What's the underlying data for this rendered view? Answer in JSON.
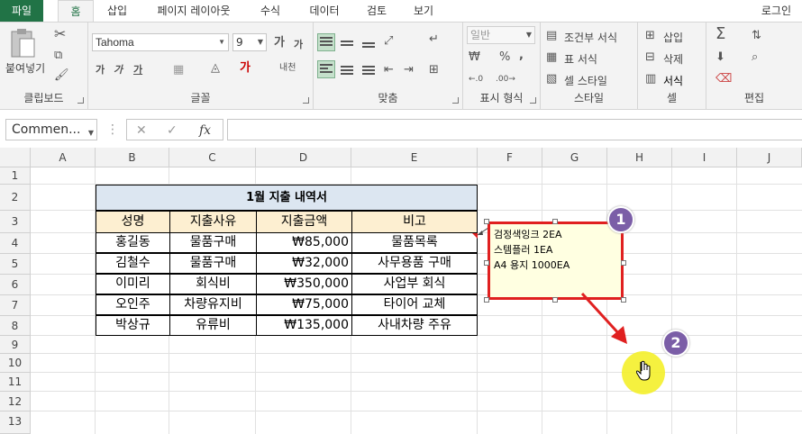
{
  "ribbon_tabs": [
    "파일",
    "홈",
    "삽입",
    "페이지 레이아웃",
    "수식",
    "데이터",
    "검토",
    "보기"
  ],
  "login_label": "로그인",
  "clipboard": {
    "paste_label": "붙여넣기",
    "group_label": "클립보드"
  },
  "font": {
    "name": "Tahoma",
    "size": "9",
    "group_label": "글꼴",
    "bold": "가",
    "italic": "가",
    "underline": "가",
    "grow": "가",
    "shrink": "가",
    "phonetic": "내천"
  },
  "alignment": {
    "group_label": "맞춤"
  },
  "number": {
    "format": "일반",
    "group_label": "표시 형식",
    "percent": "%",
    "comma": ","
  },
  "styles": {
    "conditional": "조건부 서식",
    "table": "표 서식",
    "cell": "셀 스타일",
    "group_label": "스타일"
  },
  "cells": {
    "insert": "삽입",
    "delete": "삭제",
    "format": "서식",
    "group_label": "셀"
  },
  "editing": {
    "group_label": "편집"
  },
  "formula_bar": {
    "name_box": "Commen...",
    "fx": "fx"
  },
  "columns": [
    "A",
    "B",
    "C",
    "D",
    "E",
    "F",
    "G",
    "H",
    "I",
    "J"
  ],
  "rows": [
    "1",
    "2",
    "3",
    "4",
    "5",
    "6",
    "7",
    "8",
    "9",
    "10",
    "11",
    "12",
    "13"
  ],
  "table": {
    "title": "1월 지출 내역서",
    "headers": [
      "성명",
      "지출사유",
      "지출금액",
      "비고"
    ],
    "rows": [
      [
        "홍길동",
        "물품구매",
        "₩85,000",
        "물품목록"
      ],
      [
        "김철수",
        "물품구매",
        "₩32,000",
        "사무용품 구매"
      ],
      [
        "이미리",
        "회식비",
        "₩350,000",
        "사업부 회식"
      ],
      [
        "오인주",
        "차량유지비",
        "₩75,000",
        "타이어 교체"
      ],
      [
        "박상규",
        "유류비",
        "₩135,000",
        "사내차량 주유"
      ]
    ]
  },
  "comment": {
    "lines": [
      "검정색잉크 2EA",
      "스템플러 1EA",
      "A4 용지 1000EA"
    ]
  },
  "badges": [
    "1",
    "2"
  ],
  "colors": {
    "accent": "#217346",
    "title_fill": "#dce6f1",
    "header_fill": "#fdefd1",
    "comment_border": "#e02020",
    "badge": "#7b5ea7"
  }
}
